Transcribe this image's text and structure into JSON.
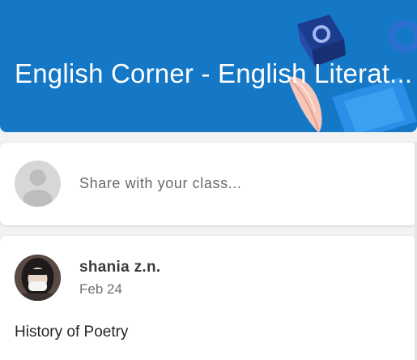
{
  "banner": {
    "title": "English Corner - English Literat...",
    "color": "#1478c7"
  },
  "share": {
    "placeholder": "Share with your class...",
    "avatar_icon": "default-user-avatar-icon"
  },
  "post": {
    "author": "shania z.n.",
    "date": "Feb 24",
    "body": "History of Poetry",
    "avatar_icon": "profile-photo"
  }
}
